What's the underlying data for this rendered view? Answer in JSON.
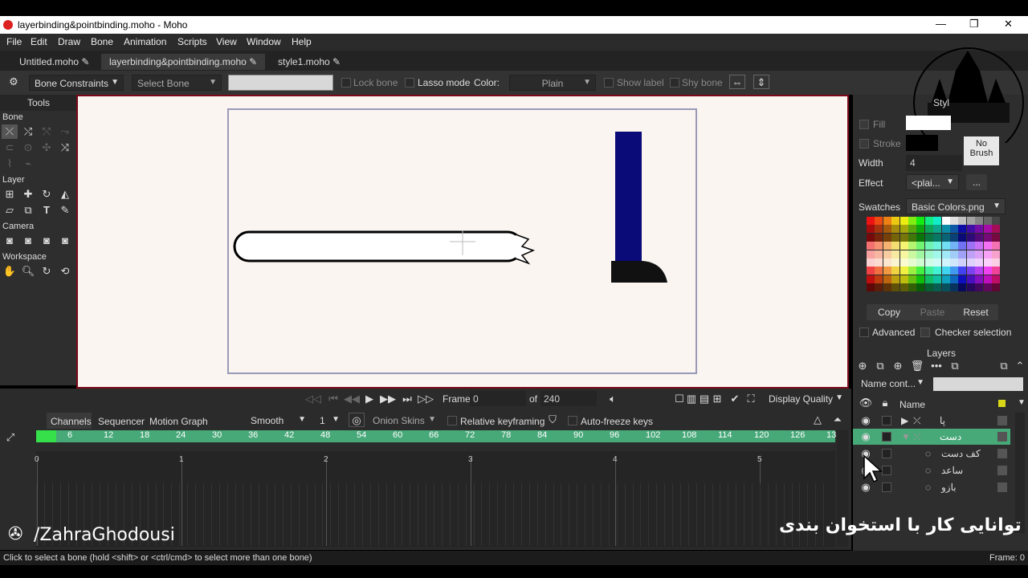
{
  "window": {
    "title": "layerbinding&pointbinding.moho - Moho",
    "controls": [
      "—",
      "❐",
      "✕"
    ]
  },
  "menu": [
    "File",
    "Edit",
    "Draw",
    "Bone",
    "Animation",
    "Scripts",
    "View",
    "Window",
    "Help"
  ],
  "tabs": [
    {
      "label": "Untitled.moho"
    },
    {
      "label": "layerbinding&pointbinding.moho"
    },
    {
      "label": "style1.moho"
    }
  ],
  "tool_options": {
    "bone_constraints": "Bone Constraints",
    "select_bone": "Select Bone",
    "lock_bone": "Lock bone",
    "lasso_mode": "Lasso mode",
    "color_label": "Color:",
    "color_value": "Plain",
    "show_label": "Show label",
    "shy_bone": "Shy bone"
  },
  "tools": {
    "title": "Tools",
    "bone": "Bone",
    "layer": "Layer",
    "camera": "Camera",
    "workspace": "Workspace"
  },
  "style": {
    "tab": "Styl",
    "fill": "Fill",
    "stroke": "Stroke",
    "width_label": "Width",
    "width_value": "4",
    "effect_label": "Effect",
    "effect_value": "<plai...",
    "effect_more": "...",
    "no_brush": "No Brush",
    "swatches_label": "Swatches",
    "swatches_value": "Basic Colors.png",
    "copy": "Copy",
    "paste": "Paste",
    "reset": "Reset",
    "advanced": "Advanced",
    "checker": "Checker selection"
  },
  "layers": {
    "title": "Layers",
    "filter": "Name cont...",
    "name_header": "Name",
    "rows": [
      {
        "name": "پا"
      },
      {
        "name": "دست"
      },
      {
        "name": "کف دست"
      },
      {
        "name": "ساعد"
      },
      {
        "name": "بازو"
      }
    ]
  },
  "transport": {
    "frame_label": "Frame",
    "frame_value": "0",
    "of_label": "of",
    "total": "240",
    "quality": "Display Quality"
  },
  "timeline": {
    "tabs": [
      "Channels",
      "Sequencer",
      "Motion Graph"
    ],
    "interp": "Smooth",
    "interval": "1",
    "onion": "Onion Skins",
    "relative": "Relative keyframing",
    "autofreeze": "Auto-freeze keys",
    "ruler": [
      "0",
      "6",
      "12",
      "18",
      "24",
      "30",
      "36",
      "42",
      "48",
      "54",
      "60",
      "66",
      "72",
      "78",
      "84",
      "90",
      "96",
      "102",
      "108",
      "114",
      "120",
      "126",
      "13"
    ],
    "seconds": [
      "0",
      "1",
      "2",
      "3",
      "4",
      "5"
    ]
  },
  "status": {
    "text": "Click to select a bone (hold <shift> or <ctrl/cmd> to select more than one bone)",
    "frame": "Frame: 0"
  },
  "overlay": {
    "handle": "/ZahraGhodousi",
    "caption": "توانایی کار با استخوان بندی"
  },
  "colors": {
    "accent": "#47a878",
    "canvas": "#faf5f0",
    "border": "#7a0a1a",
    "selected_layer": "#47a878"
  }
}
